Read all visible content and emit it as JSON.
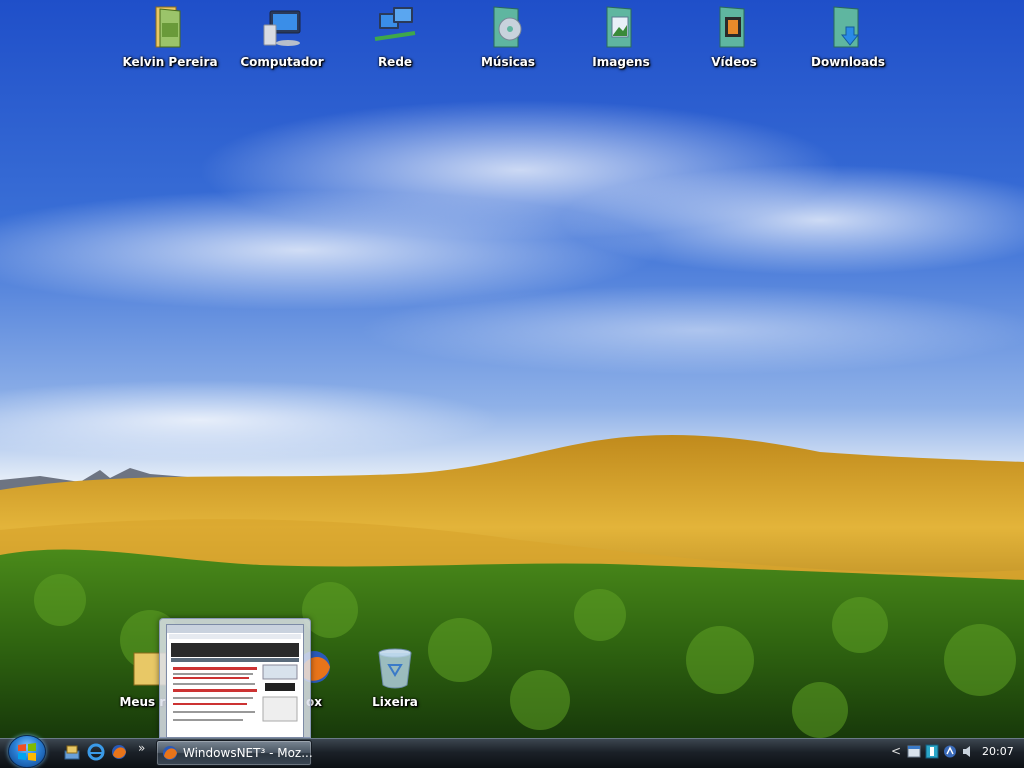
{
  "desktop": {
    "icons": [
      {
        "label": "Kelvin Pereira",
        "icon": "user-folder-icon"
      },
      {
        "label": "Computador",
        "icon": "computer-icon"
      },
      {
        "label": "Rede",
        "icon": "network-icon"
      },
      {
        "label": "Músicas",
        "icon": "music-folder-icon"
      },
      {
        "label": "Imagens",
        "icon": "pictures-folder-icon"
      },
      {
        "label": "Vídeos",
        "icon": "videos-folder-icon"
      },
      {
        "label": "Downloads",
        "icon": "downloads-folder-icon"
      }
    ],
    "bottom_icons": [
      {
        "label": "Meus rec",
        "icon": "documents-folder-icon"
      },
      {
        "label": "ox",
        "icon": "firefox-icon"
      },
      {
        "label": "Lixeira",
        "icon": "recycle-bin-icon"
      }
    ]
  },
  "taskbar": {
    "quicklaunch_more": "»",
    "task_title": "WindowsNET³ - Moz...",
    "tray_arrow": "<",
    "clock": "20:07"
  },
  "colors": {
    "sky": "#2a62d6",
    "taskbar": "#1b2128",
    "label_text": "#ffffff"
  }
}
